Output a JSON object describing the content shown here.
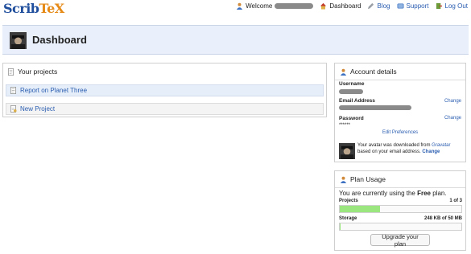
{
  "logo": {
    "part1": "Scrib",
    "part2": "TeX"
  },
  "topnav": {
    "welcome_label": "Welcome",
    "dashboard": "Dashboard",
    "blog": "Blog",
    "support": "Support",
    "logout": "Log Out"
  },
  "header": {
    "title": "Dashboard"
  },
  "projects": {
    "title": "Your projects",
    "items": [
      {
        "name": "Report on Planet Three"
      }
    ],
    "new_project": "New Project"
  },
  "account": {
    "title": "Account details",
    "username_label": "Username",
    "email_label": "Email Address",
    "email_change": "Change",
    "password_label": "Password",
    "password_value": "******",
    "password_change": "Change",
    "edit_preferences": "Edit Preferences",
    "avatar_note_prefix": "Your avatar was downloaded from",
    "gravatar_link": "Gravatar",
    "avatar_note_suffix": "based on your email address.",
    "avatar_change": "Change"
  },
  "plan": {
    "title": "Plan Usage",
    "using_prefix": "You are currently using the",
    "plan_name": "Free",
    "using_suffix": "plan.",
    "projects_label": "Projects",
    "projects_count": "1 of 3",
    "projects_fraction": 0.333,
    "storage_label": "Storage",
    "storage_count": "248 KB of 50 MB",
    "storage_fraction": 0.005,
    "upgrade_button": "Upgrade your plan"
  },
  "colors": {
    "accent": "#2a5db0",
    "logo_orange": "#e58a16",
    "progress": "#9ce67f",
    "header_bg": "#e9f0fb"
  }
}
